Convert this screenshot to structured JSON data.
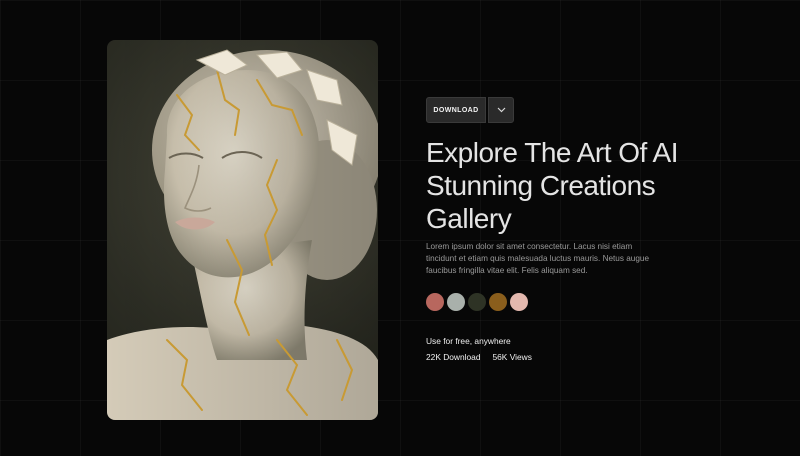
{
  "toolbar": {
    "download_label": "DOWNLOAD",
    "dropdown_icon": "chevron-down-icon"
  },
  "hero": {
    "title_lines": [
      "Explore The Art Of AI",
      "Stunning Creations",
      "Gallery"
    ],
    "description_lines": [
      "Lorem ipsum dolor sit amet consectetur. Lacus nisi etiam",
      "tincidunt et etiam quis malesuada luctus mauris. Netus augue",
      "faucibus fringilla vitae elit. Felis aliquam sed."
    ]
  },
  "palette": {
    "colors": [
      "#b8675e",
      "#a9b0ab",
      "#2e3325",
      "#8a5e1c",
      "#e3b8ae"
    ]
  },
  "meta": {
    "license": "Use for free, anywhere",
    "downloads": "22K Download",
    "views": "56K Views"
  },
  "theme": {
    "background": "#070707",
    "button": "#2a2a2a",
    "gold": "#c89a34"
  }
}
